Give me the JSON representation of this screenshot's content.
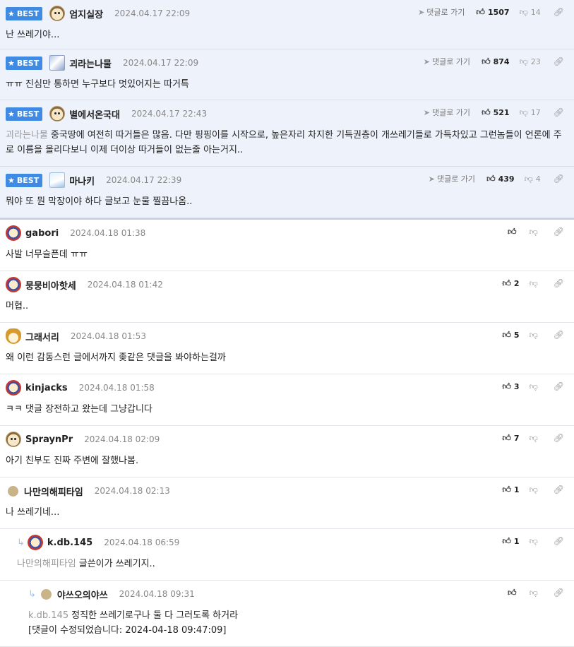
{
  "best_label": "BEST",
  "goto_label": "댓글로 가기",
  "best_comments": [
    {
      "nick": "엄지실장",
      "date": "2024.04.17 22:09",
      "likes": "1507",
      "dislikes": "14",
      "text": "난 쓰레기야...",
      "avatar": "dog"
    },
    {
      "nick": "괴라는나물",
      "date": "2024.04.17 22:09",
      "likes": "874",
      "dislikes": "23",
      "text": "ㅠㅠ 진심만 통하면 누구보다 멋있어지는 따거특",
      "avatar": "photo"
    },
    {
      "nick": "별에서온국대",
      "date": "2024.04.17 22:43",
      "likes": "521",
      "dislikes": "17",
      "mention": "괴라는나물",
      "text": "중국땅에 여전히 따거들은 많음. 다만 핑핑이를 시작으로, 높은자리 차지한 기득권층이 개쓰레기들로 가득차있고 그런놈들이 언론에 주로 이름을 올리다보니 이제 더이상 따거들이 없는줄 아는거지..",
      "avatar": "dog"
    },
    {
      "nick": "마나키",
      "date": "2024.04.17 22:39",
      "likes": "439",
      "dislikes": "4",
      "text": "뭐야 또 뭔 막장이야 하다 글보고 눈물 찔끔나옴..",
      "avatar": "photo2"
    }
  ],
  "comments": [
    {
      "nick": "gabori",
      "date": "2024.04.18 01:38",
      "likes": "",
      "text": "사발 너무슬픈데 ㅠㅠ",
      "avatar": "lion"
    },
    {
      "nick": "뭉뭉비아핫세",
      "date": "2024.04.18 01:42",
      "likes": "2",
      "text": "머협..",
      "avatar": "lion"
    },
    {
      "nick": "그래서리",
      "date": "2024.04.18 01:53",
      "likes": "5",
      "text": "왜 이런 감동스런 글에서까지 좆같은 댓글을 봐야하는걸까",
      "avatar": "fox"
    },
    {
      "nick": "kinjacks",
      "date": "2024.04.18 01:58",
      "likes": "3",
      "text": "ㅋㅋ 댓글 장전하고 왔는데 그냥갑니다",
      "avatar": "lion"
    },
    {
      "nick": "SpraynPr",
      "date": "2024.04.18 02:09",
      "likes": "7",
      "text": "아기 친부도 진짜 주변에 잘했나봄.",
      "avatar": "dog"
    },
    {
      "nick": "나만의해피타임",
      "date": "2024.04.18 02:13",
      "likes": "1",
      "text": "나 쓰레기네...",
      "avatar": "dot"
    }
  ],
  "replies": [
    {
      "nick": "k.db.145",
      "date": "2024.04.18 06:59",
      "likes": "1",
      "mention": "나만의해피타임",
      "text": "글쓴이가 쓰레기지..",
      "avatar": "lion"
    },
    {
      "nick": "야쓰오의야쓰",
      "date": "2024.04.18 09:31",
      "likes": "",
      "mention": "k.db.145",
      "text": "정직한 쓰레기로구나 둘 다 그러도록 하거라",
      "edited": "[댓글이 수정되었습니다: 2024-04-18 09:47:09]",
      "avatar": "dot"
    }
  ]
}
